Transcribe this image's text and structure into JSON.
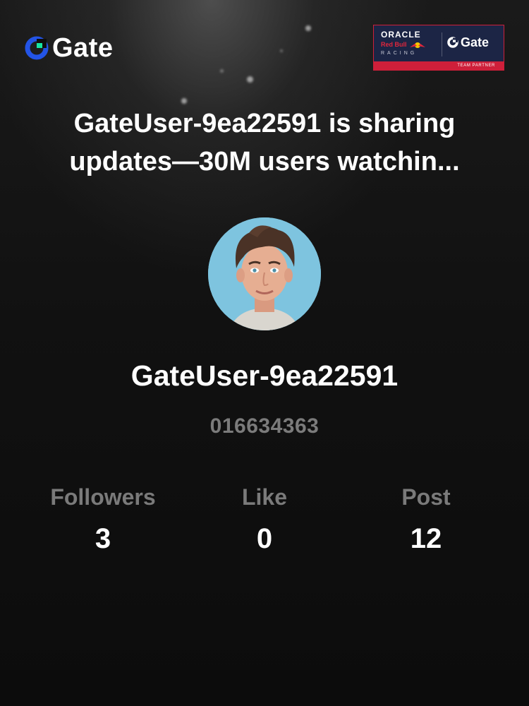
{
  "brand": {
    "logo_text": "Gate",
    "logo_icon": "gate-logo-icon",
    "accent_color": "#2354e6",
    "secondary_color": "#17e5a3"
  },
  "partner_badge": {
    "line1": "ORACLE",
    "line2": "Red Bull",
    "line3": "RACING",
    "gate_text": "Gate",
    "strip_text": "TEAM PARTNER",
    "bg_color": "#1c2545",
    "strip_color": "#ce1f3a"
  },
  "headline": "GateUser-9ea22591 is sharing updates—30M users watchin...",
  "profile": {
    "avatar_icon": "user-avatar",
    "username": "GateUser-9ea22591",
    "user_id": "016634363"
  },
  "stats": [
    {
      "label": "Followers",
      "value": "3"
    },
    {
      "label": "Like",
      "value": "0"
    },
    {
      "label": "Post",
      "value": "12"
    }
  ]
}
